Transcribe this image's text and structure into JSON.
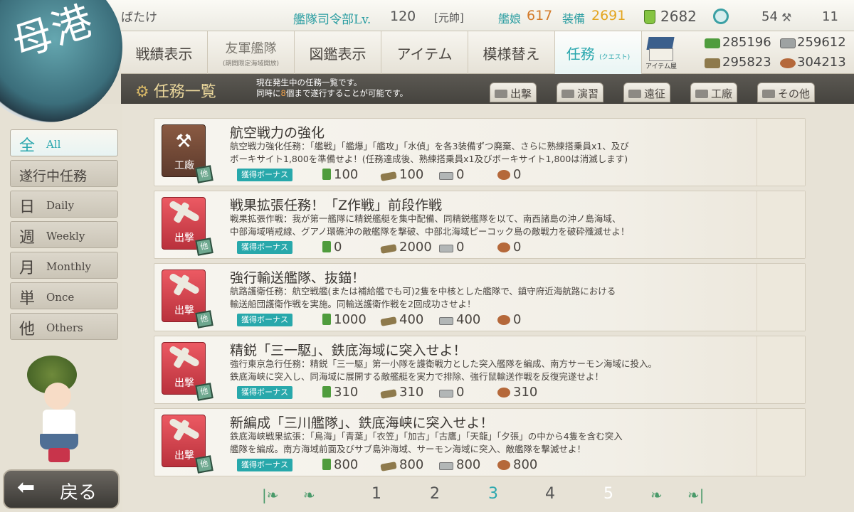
{
  "header": {
    "player_name": "ばたけ",
    "hq_label": "艦隊司令部Lv.",
    "hq_level": "120",
    "rank": "[元帥]",
    "ships_label": "艦娘",
    "ships": "617",
    "equip_label": "装備",
    "equip": "2691",
    "buckets": "2682",
    "dev_materials": "54",
    "improve_materials": "11"
  },
  "badge": {
    "label": "母港"
  },
  "nav": {
    "tabs": [
      {
        "label": "戦績表示",
        "sub": ""
      },
      {
        "label": "友軍艦隊",
        "sub": "(期間限定海域開放)"
      },
      {
        "label": "図鑑表示",
        "sub": ""
      },
      {
        "label": "アイテム",
        "sub": ""
      },
      {
        "label": "模様替え",
        "sub": ""
      },
      {
        "label": "任務",
        "sub": "(クエスト)"
      }
    ],
    "shop_label": "アイテム屋",
    "resources": {
      "fuel": "285196",
      "steel": "259612",
      "ammo": "295823",
      "bauxite": "304213"
    }
  },
  "quest_header": {
    "title": "任務一覧",
    "note_line1": "現在発生中の任務一覧です。",
    "note_line2_pre": "同時に",
    "note_line2_num": "8",
    "note_line2_post": "個まで遂行することが可能です。",
    "categories": [
      "出撃",
      "演習",
      "遠征",
      "工廠",
      "その他"
    ]
  },
  "sidebar": {
    "items": [
      {
        "kanji": "全",
        "en": "All"
      },
      {
        "kanji": "遂行中任務",
        "en": ""
      },
      {
        "kanji": "日",
        "en": "Daily"
      },
      {
        "kanji": "週",
        "en": "Weekly"
      },
      {
        "kanji": "月",
        "en": "Monthly"
      },
      {
        "kanji": "単",
        "en": "Once"
      },
      {
        "kanji": "他",
        "en": "Others"
      }
    ],
    "back_label": "戻る"
  },
  "quests": [
    {
      "category": "工廠",
      "title": "航空戦力の強化",
      "desc1": "航空戦力強化任務：「艦戦」「艦爆」「艦攻」「水偵」を各3装備ずつ廃棄、さらに熟練搭乗員x1、及び",
      "desc2": "ボーキサイト1,800を準備せよ！(任務達成後、熟練搭乗員x1及びボーキサイト1,800は消滅します)",
      "bonus": "獲得ボーナス",
      "fuel": "100",
      "ammo": "100",
      "steel": "0",
      "bauxite": "0",
      "tag": "他"
    },
    {
      "category": "出撃",
      "title": "戦果拡張任務！「Z作戦」前段作戦",
      "desc1": "戦果拡張作戦：我が第一艦隊に精鋭艦艇を集中配備、同精鋭艦隊を以て、南西諸島の沖ノ島海域、",
      "desc2": "中部海域哨戒線、グアノ環礁沖の敵艦隊を撃破、中部北海域ピーコック島の敵戦力を破砕殲滅せよ！",
      "bonus": "獲得ボーナス",
      "fuel": "0",
      "ammo": "2000",
      "steel": "0",
      "bauxite": "0",
      "tag": "他"
    },
    {
      "category": "出撃",
      "title": "強行輸送艦隊、抜錨！",
      "desc1": "航路護衛任務：航空戦艦(または補給艦でも可)2隻を中核とした艦隊で、鎮守府近海航路における",
      "desc2": "輸送船団護衛作戦を実施。同輸送護衛作戦を2回成功させよ！",
      "bonus": "獲得ボーナス",
      "fuel": "1000",
      "ammo": "400",
      "steel": "400",
      "bauxite": "0",
      "tag": "他"
    },
    {
      "category": "出撃",
      "title": "精鋭「三一駆」、鉄底海域に突入せよ！",
      "desc1": "強行東京急行任務：精鋭「三一駆」第一小隊を護衛戦力とした突入艦隊を編成、南方サーモン海域に投入。",
      "desc2": "鉄底海峡に突入し、同海域に展開する敵艦艇を実力で排除、強行鼠輸送作戦を反復完遂せよ！",
      "bonus": "獲得ボーナス",
      "fuel": "310",
      "ammo": "310",
      "steel": "0",
      "bauxite": "310",
      "tag": "他"
    },
    {
      "category": "出撃",
      "title": "新編成「三川艦隊」、鉄底海峡に突入せよ！",
      "desc1": "鉄底海峡戦果拡張：「鳥海」「青葉」「衣笠」「加古」「古鷹」「天龍」「夕張」の中から4隻を含む突入",
      "desc2": "艦隊を編成。南方海域前面及びサブ島沖海域、サーモン海域に突入、敵艦隊を撃滅せよ！",
      "bonus": "獲得ボーナス",
      "fuel": "800",
      "ammo": "800",
      "steel": "800",
      "bauxite": "800",
      "tag": "他"
    }
  ],
  "pager": {
    "pages": [
      "1",
      "2",
      "3",
      "4",
      "5"
    ],
    "current": "3"
  }
}
